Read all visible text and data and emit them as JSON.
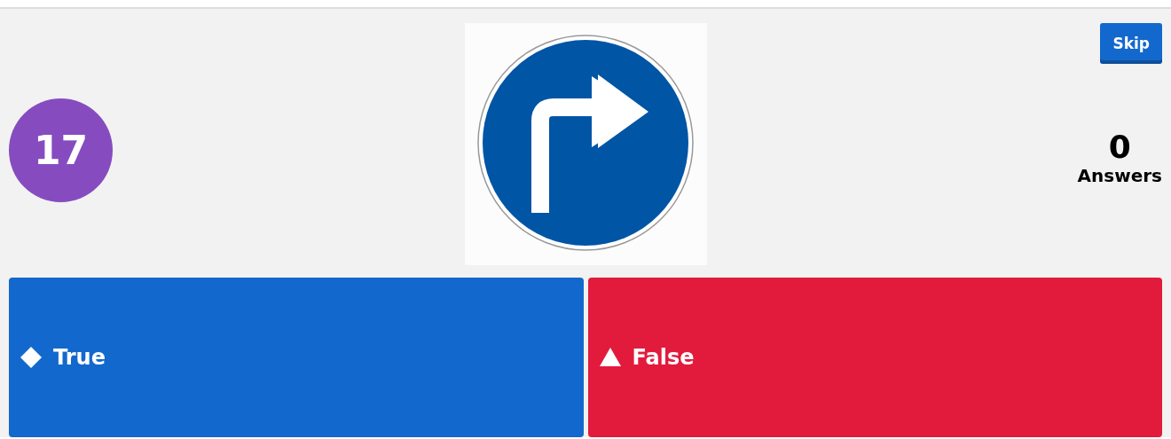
{
  "question_number": "17",
  "skip_button": "Skip",
  "answers_count": {
    "value": "0",
    "label": "Answers"
  },
  "answers": [
    {
      "kind": "diamond",
      "label": "True",
      "color": "#1368ce"
    },
    {
      "kind": "triangle",
      "label": "False",
      "color": "#e21b3c"
    }
  ]
}
